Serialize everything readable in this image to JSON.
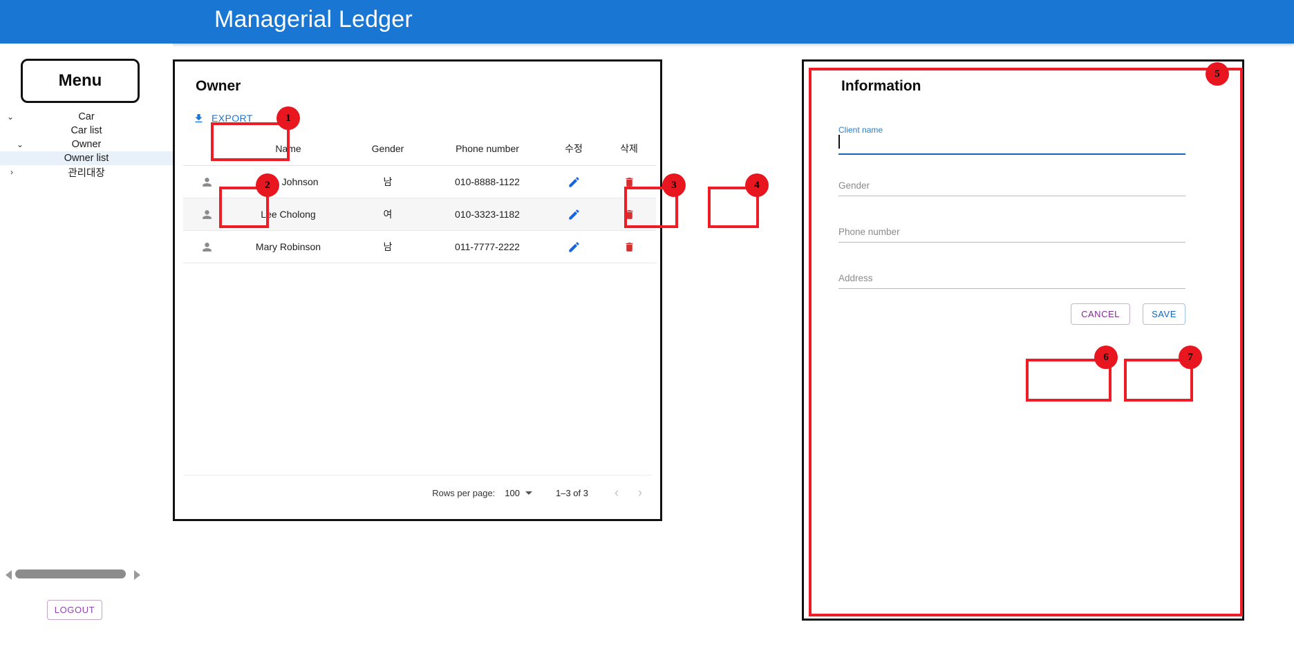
{
  "header": {
    "title": "Managerial Ledger",
    "bg_color": "#1976d2"
  },
  "sidebar": {
    "menu_label": "Menu",
    "tree": [
      {
        "label": "Car",
        "chevron": "chevron-down",
        "indent": 0,
        "selected": false
      },
      {
        "label": "Car list",
        "chevron": "",
        "indent": 1,
        "selected": false
      },
      {
        "label": "Owner",
        "chevron": "chevron-down",
        "indent": 1,
        "selected": false
      },
      {
        "label": "Owner list",
        "chevron": "",
        "indent": 2,
        "selected": true
      },
      {
        "label": "관리대장",
        "chevron": "chevron-right",
        "indent": 0,
        "selected": false
      }
    ],
    "logout_label": "LOGOUT"
  },
  "owner_card": {
    "title": "Owner",
    "export_label": "EXPORT",
    "columns": [
      "",
      "Name",
      "Gender",
      "Phone number",
      "수정",
      "삭제"
    ],
    "rows": [
      {
        "name": "John Johnson",
        "gender": "남",
        "phone": "010-8888-1122"
      },
      {
        "name": "Lee Cholong",
        "gender": "여",
        "phone": "010-3323-1182"
      },
      {
        "name": "Mary Robinson",
        "gender": "남",
        "phone": "011-7777-2222"
      }
    ],
    "footer": {
      "rows_per_page_label": "Rows per page:",
      "rows_per_page_value": "100",
      "range_label": "1–3 of 3",
      "prev_label": "‹",
      "next_label": "›"
    }
  },
  "info_card": {
    "title": "Information",
    "fields": [
      {
        "label": "Client name",
        "value": "",
        "focused": true
      },
      {
        "label": "Gender",
        "value": "",
        "focused": false
      },
      {
        "label": "Phone number",
        "value": "",
        "focused": false
      },
      {
        "label": "Address",
        "value": "",
        "focused": false
      }
    ],
    "cancel_label": "CANCEL",
    "save_label": "SAVE"
  },
  "annotations": [
    {
      "id": "1",
      "label": "1"
    },
    {
      "id": "2",
      "label": "2"
    },
    {
      "id": "3",
      "label": "3"
    },
    {
      "id": "4",
      "label": "4"
    },
    {
      "id": "5",
      "label": "5"
    },
    {
      "id": "6",
      "label": "6"
    },
    {
      "id": "7",
      "label": "7"
    }
  ],
  "colors": {
    "accent_blue": "#1976d2",
    "delete_red": "#d32f2f",
    "annotation_red": "#e8161f",
    "purple": "#8e44ad"
  }
}
